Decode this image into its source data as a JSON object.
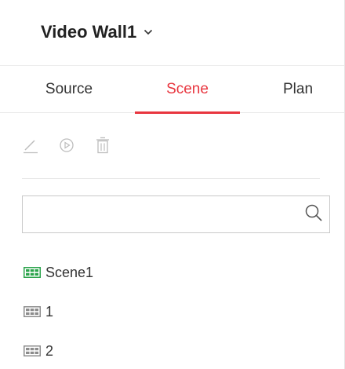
{
  "header": {
    "wall_name": "Video Wall1"
  },
  "tabs": [
    {
      "label": "Source",
      "active": false
    },
    {
      "label": "Scene",
      "active": true
    },
    {
      "label": "Plan",
      "active": false
    }
  ],
  "toolbar": {
    "icons": [
      "edit-icon",
      "play-icon",
      "delete-icon"
    ]
  },
  "search": {
    "placeholder": "",
    "value": ""
  },
  "scenes": [
    {
      "label": "Scene1",
      "active": true
    },
    {
      "label": "1",
      "active": false
    },
    {
      "label": "2",
      "active": false
    }
  ],
  "colors": {
    "accent": "#e8363f",
    "active_scene_icon": "#2aa34a",
    "inactive_scene_icon": "#8c8c8c",
    "disabled_tool": "#bdbdbd"
  }
}
